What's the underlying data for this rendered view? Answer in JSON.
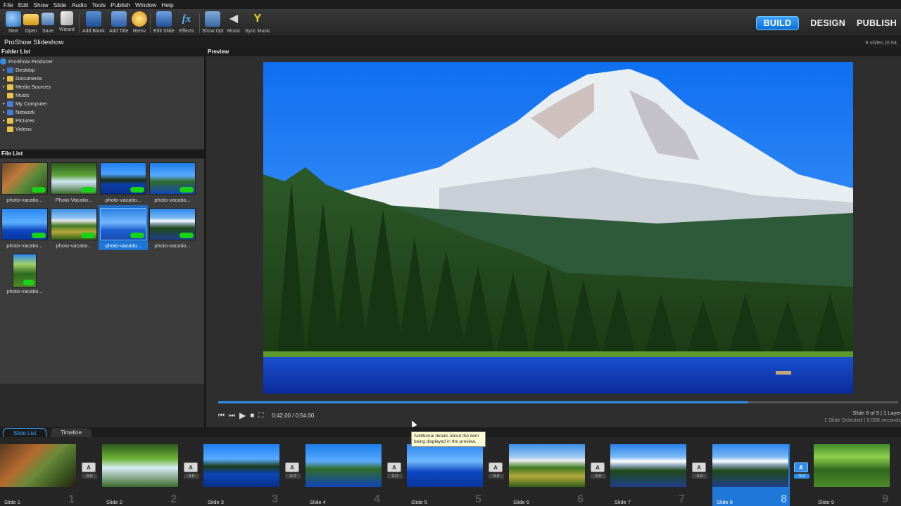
{
  "menu": [
    "File",
    "Edit",
    "Show",
    "Slide",
    "Audio",
    "Tools",
    "Publish",
    "Window",
    "Help"
  ],
  "toolbar": {
    "buttons": [
      "New",
      "Open",
      "Save",
      "Wizard",
      "Add Blank",
      "Add Title",
      "Remv",
      "Edit Slide",
      "Effects",
      "Show Opt",
      "Music",
      "Sync Music"
    ],
    "modes": [
      "BUILD",
      "DESIGN",
      "PUBLISH"
    ],
    "active_mode": "BUILD"
  },
  "title": "ProShow Slideshow",
  "slide_count": "9 slides (0:54",
  "folder_list": {
    "heading": "Folder List",
    "items": [
      "ProShow Producer",
      "Desktop",
      "Documents",
      "Media Sources",
      "Music",
      "My Computer",
      "Network",
      "Pictures",
      "Videos"
    ]
  },
  "file_list": {
    "heading": "File List",
    "files": [
      "photo-vacatio...",
      "Photo-Vacatio...",
      "photo-vacatio...",
      "photo-vacatio...",
      "photo-vacatio...",
      "photo-vacatio...",
      "photo-vacatio...",
      "photo-vacatio...",
      "photo-vacatio..."
    ]
  },
  "preview": {
    "heading": "Preview",
    "time": "0:42.00 / 0:54.00",
    "progress": 0.78,
    "slide_info": "Slide 8 of 9  |  1 Layer",
    "selection_info": "1 Slide Selected  |  9.000 seconds",
    "tooltip": "Additional details about the item being displayed in the preview."
  },
  "bottom_tabs": [
    "Slide List",
    "Timeline"
  ],
  "slides": [
    {
      "name": "Slide 1",
      "num": "1",
      "trans": "3.0"
    },
    {
      "name": "Slide 2",
      "num": "2",
      "trans": "3.0"
    },
    {
      "name": "Slide 3",
      "num": "3",
      "trans": "3.0"
    },
    {
      "name": "Slide 4",
      "num": "4",
      "trans": "3.0"
    },
    {
      "name": "Slide 5",
      "num": "5",
      "trans": "3.0"
    },
    {
      "name": "Slide 6",
      "num": "6",
      "trans": "3.0"
    },
    {
      "name": "Slide 7",
      "num": "7",
      "trans": "3.0"
    },
    {
      "name": "Slide 8",
      "num": "8",
      "trans": "3.0"
    },
    {
      "name": "Slide 9",
      "num": "9",
      "trans": ""
    }
  ],
  "transition_icon_text": "A",
  "colors": {
    "accent": "#2f8ee8",
    "background": "#2b2b2b",
    "file_badge": "#18d218"
  }
}
